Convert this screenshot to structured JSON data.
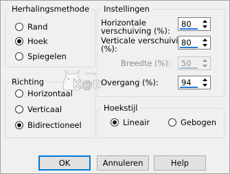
{
  "repetition": {
    "title": "Herhalingsmethode",
    "options": [
      "Rand",
      "Hoek",
      "Spiegelen"
    ],
    "selected": "Hoek"
  },
  "direction": {
    "title": "Richting",
    "options": [
      "Horizontaal",
      "Verticaal",
      "Bidirectioneel"
    ],
    "selected": "Bidirectioneel"
  },
  "settings": {
    "title": "Instellingen",
    "horizontal_shift": {
      "label_line1": "Horizontale",
      "label_line2": "verschuiving (%):",
      "value": "80"
    },
    "vertical_shift": {
      "label_line1": "Verticale verschuiving",
      "label_line2": "(%):",
      "value": "80"
    },
    "width": {
      "label": "Breedte (%):",
      "value": "50",
      "disabled": true
    },
    "transition": {
      "label": "Overgang (%):",
      "value": "94"
    }
  },
  "corner_style": {
    "title": "Hoekstijl",
    "options": [
      "Lineair",
      "Gebogen"
    ],
    "selected": "Lineair"
  },
  "watermark": {
    "text": "K@D",
    "small_text": "Emily"
  },
  "buttons": {
    "ok": "OK",
    "cancel": "Annuleren",
    "help": "Help"
  }
}
